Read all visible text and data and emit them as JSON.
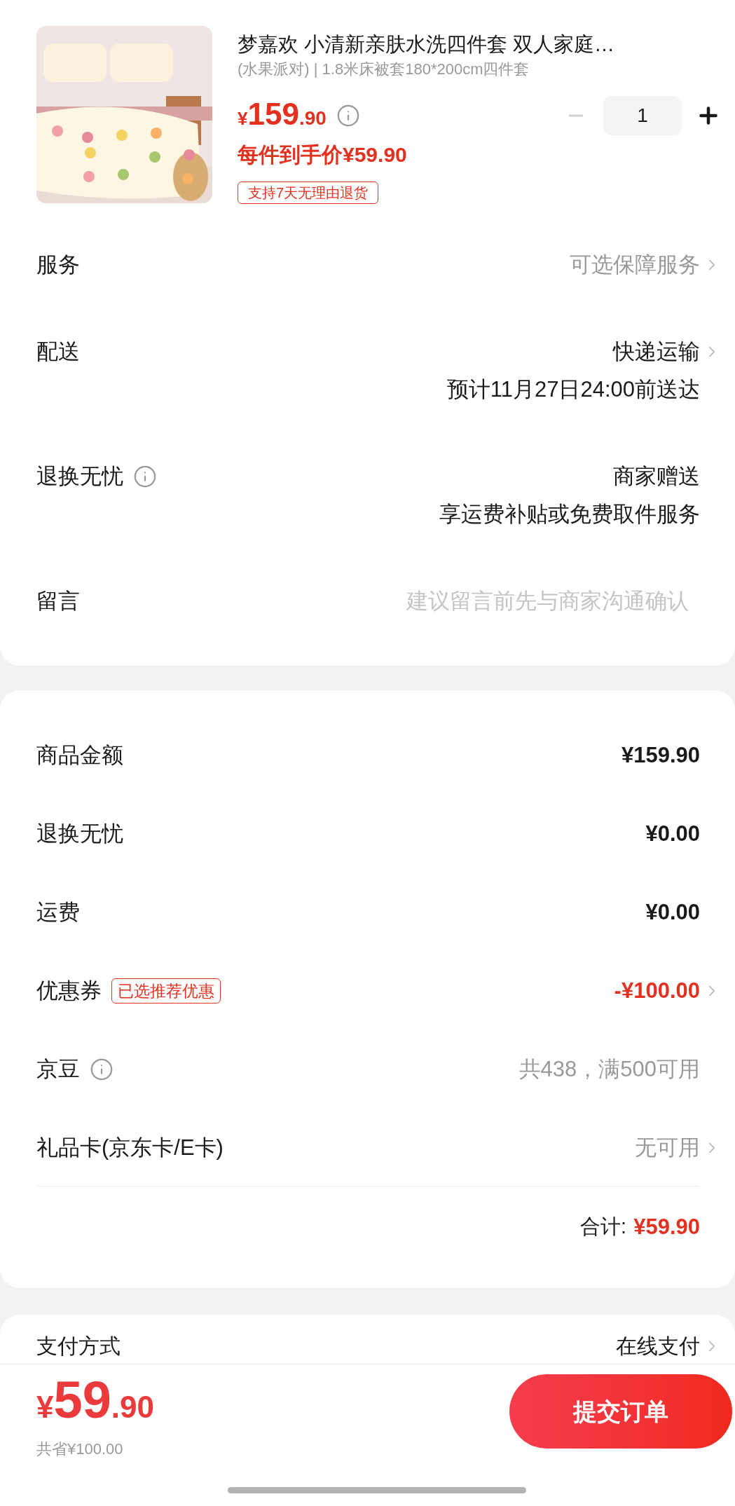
{
  "product": {
    "title": "梦嘉欢 小清新亲肤水洗四件套 双人家庭…",
    "spec": "(水果派对) | 1.8米床被套180*200cm四件套",
    "price": {
      "currency": "¥",
      "integer": "159",
      "decimal": ".90"
    },
    "per_item_price": "每件到手价¥59.90",
    "tag": "支持7天无理由退货",
    "quantity": "1",
    "decrease_disabled": true
  },
  "options": [
    {
      "kind": "link",
      "label": "服务",
      "info": false,
      "value": "可选保障服务",
      "muted": true,
      "chevron": true
    },
    {
      "kind": "link",
      "label": "配送",
      "info": false,
      "value": "快递运输",
      "muted": false,
      "subtext": "预计11月27日24:00前送达",
      "chevron": true
    },
    {
      "kind": "link",
      "label": "退换无忧",
      "info": true,
      "value": "商家赠送",
      "muted": false,
      "subtext": "享运费补贴或免费取件服务",
      "chevron": false
    },
    {
      "kind": "input",
      "label": "留言",
      "placeholder": "建议留言前先与商家沟通确认"
    }
  ],
  "summary": {
    "rows": [
      {
        "label": "商品金额",
        "value": "¥159.90",
        "kind": "amount",
        "info": false,
        "chevron": false
      },
      {
        "label": "退换无忧",
        "value": "¥0.00",
        "kind": "amount",
        "info": false,
        "chevron": false
      },
      {
        "label": "运费",
        "value": "¥0.00",
        "kind": "amount",
        "info": false,
        "chevron": false
      },
      {
        "label": "优惠券",
        "badge": "已选推荐优惠",
        "value": "-¥100.00",
        "kind": "discount",
        "info": false,
        "chevron": true
      },
      {
        "label": "京豆",
        "value": "共438，满500可用",
        "kind": "note",
        "info": true,
        "chevron": false
      },
      {
        "label": "礼品卡(京东卡/E卡)",
        "value": "无可用",
        "kind": "note",
        "info": false,
        "chevron": true
      }
    ],
    "total_label": "合计:",
    "total_value": "¥59.90"
  },
  "payment": {
    "label": "支付方式",
    "value": "在线支付"
  },
  "footer": {
    "price": {
      "currency": "¥",
      "integer": "59",
      "decimal": ".90"
    },
    "savings": "共省¥100.00",
    "submit": "提交订单"
  }
}
